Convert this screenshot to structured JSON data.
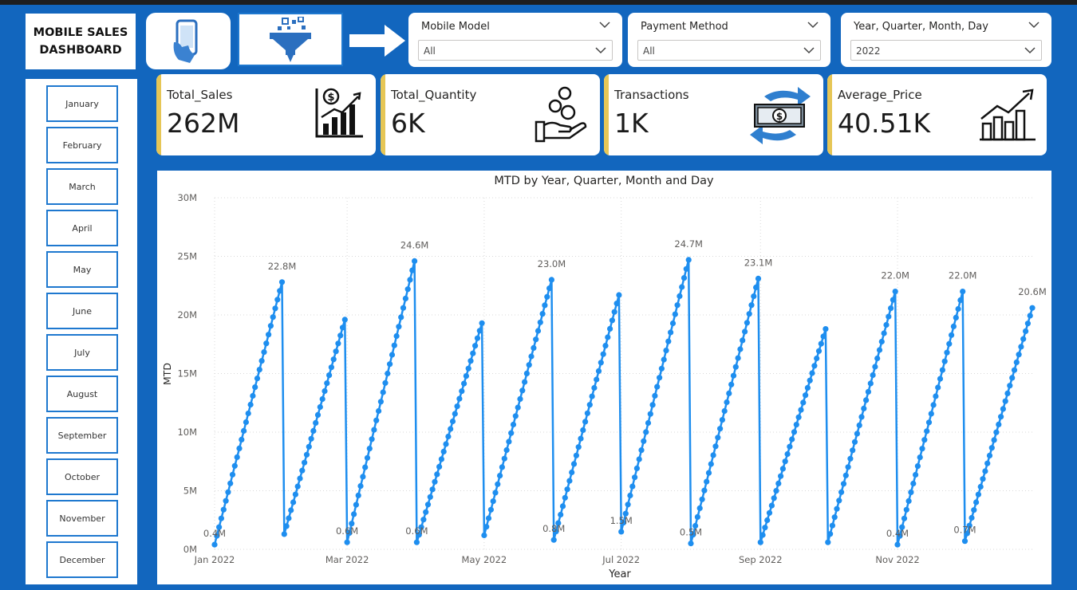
{
  "dashboard": {
    "title": "MOBILE SALES\nDASHBOARD"
  },
  "slicers": {
    "mobile_model": {
      "title": "Mobile Model",
      "value": "All"
    },
    "payment_method": {
      "title": "Payment Method",
      "value": "All"
    },
    "date_hierarchy": {
      "title": "Year, Quarter, Month, Day",
      "value": "2022"
    }
  },
  "months": [
    "January",
    "February",
    "March",
    "April",
    "May",
    "June",
    "July",
    "August",
    "September",
    "October",
    "November",
    "December"
  ],
  "cards": [
    {
      "label": "Total_Sales",
      "value": "262M",
      "icon": "sales-chart-icon"
    },
    {
      "label": "Total_Quantity",
      "value": "6K",
      "icon": "coins-hand-icon"
    },
    {
      "label": "Transactions",
      "value": "1K",
      "icon": "cash-exchange-icon"
    },
    {
      "label": "Average_Price",
      "value": "40.51K",
      "icon": "growth-chart-icon"
    }
  ],
  "colors": {
    "background": "#1266be",
    "accent": "#e6c656",
    "series": "#1e8eef",
    "border": "#1e78cf"
  },
  "chart_data": {
    "type": "line",
    "title": "MTD by Year, Quarter, Month and Day",
    "xlabel": "Year",
    "ylabel": "MTD",
    "x_range": [
      "2022-01-01",
      "2022-12-31"
    ],
    "ylim": [
      0,
      30000000
    ],
    "y_ticks": [
      {
        "value": 0,
        "label": "0M"
      },
      {
        "value": 5000000,
        "label": "5M"
      },
      {
        "value": 10000000,
        "label": "10M"
      },
      {
        "value": 15000000,
        "label": "15M"
      },
      {
        "value": 20000000,
        "label": "20M"
      },
      {
        "value": 25000000,
        "label": "25M"
      },
      {
        "value": 30000000,
        "label": "30M"
      }
    ],
    "x_ticks": [
      {
        "date": "2022-01-01",
        "label": "Jan 2022"
      },
      {
        "date": "2022-03-01",
        "label": "Mar 2022"
      },
      {
        "date": "2022-05-01",
        "label": "May 2022"
      },
      {
        "date": "2022-07-01",
        "label": "Jul 2022"
      },
      {
        "date": "2022-09-01",
        "label": "Sep 2022"
      },
      {
        "date": "2022-11-01",
        "label": "Nov 2022"
      }
    ],
    "grid": true,
    "series": [
      {
        "values": [
          {
            "month": "2022-01",
            "start": 400000,
            "end": 22800000,
            "start_label": "0.4M",
            "end_label": "22.8M"
          },
          {
            "month": "2022-02",
            "start": 1300000,
            "end": 19600000
          },
          {
            "month": "2022-03",
            "start": 600000,
            "end": 24600000,
            "start_label": "0.6M",
            "end_label": "24.6M"
          },
          {
            "month": "2022-04",
            "start": 600000,
            "end": 19300000,
            "start_label": "0.6M"
          },
          {
            "month": "2022-05",
            "start": 1200000,
            "end": 23000000,
            "end_label": "23.0M"
          },
          {
            "month": "2022-06",
            "start": 800000,
            "end": 21700000,
            "start_label": "0.8M"
          },
          {
            "month": "2022-07",
            "start": 1500000,
            "end": 24700000,
            "start_label": "1.5M",
            "end_label": "24.7M"
          },
          {
            "month": "2022-08",
            "start": 500000,
            "end": 23100000,
            "start_label": "0.5M",
            "end_label": "23.1M"
          },
          {
            "month": "2022-09",
            "start": 600000,
            "end": 18800000
          },
          {
            "month": "2022-10",
            "start": 600000,
            "end": 22000000,
            "end_label": "22.0M"
          },
          {
            "month": "2022-11",
            "start": 400000,
            "end": 22000000,
            "start_label": "0.4M",
            "end_label": "22.0M"
          },
          {
            "month": "2022-12",
            "start": 700000,
            "end": 20600000,
            "start_label": "0.7M",
            "end_label": "20.6M"
          }
        ]
      }
    ]
  }
}
